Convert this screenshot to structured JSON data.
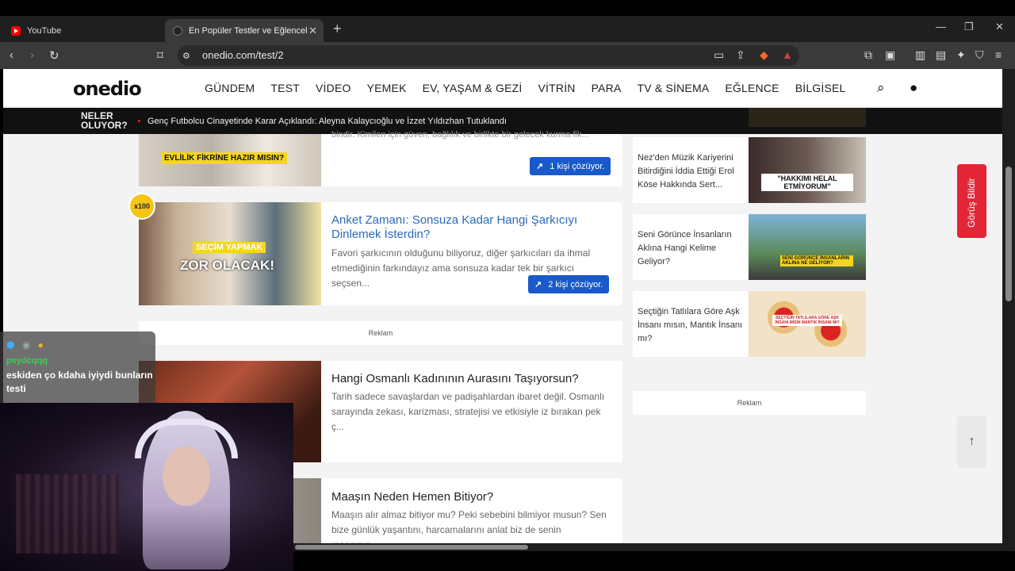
{
  "browser": {
    "tabs": [
      {
        "label": "YouTube",
        "active": false
      },
      {
        "label": "En Popüler Testler ve Eğlenceli Q",
        "active": true
      }
    ],
    "url": "onedio.com/test/2"
  },
  "header": {
    "logo": "onedio",
    "nav": [
      "GÜNDEM",
      "TEST",
      "VİDEO",
      "YEMEK",
      "EV, YAŞAM & GEZİ",
      "VİTRİN",
      "PARA",
      "TV & SİNEMA",
      "EĞLENCE",
      "BİLGİSEL"
    ]
  },
  "ticker": {
    "label": "NELER OLUYOR?",
    "text": "Genç Futbolcu Cinayetinde Karar Açıklandı: Aleyna Kalaycıoğlu ve İzzet Yıldızhan Tutuklandı"
  },
  "cards": [
    {
      "image_text": "EVLİLİK FİKRİNE HAZIR MISIN?",
      "desc_partial": "bindir. Kimilen için güven, bağlılık ve birlikte bir gelecek kurma fik...",
      "solvers": "1 kişi çözüyor."
    },
    {
      "badge": "x100",
      "image_text_1": "SEÇİM YAPMAK",
      "image_text_2": "ZOR OLACAK!",
      "title": "Anket Zamanı: Sonsuza Kadar Hangi Şarkıcıyı Dinlemek İsterdin?",
      "desc": "Favori şarkıcının olduğunu biliyoruz, diğer şarkıcıları da ihmal etmediğinin farkındayız ama sonsuza kadar tek bir şarkıcı seçsen...",
      "solvers": "2 kişi çözüyor."
    },
    {
      "title": "Hangi Osmanlı Kadınının Aurasını Taşıyorsun?",
      "desc": "Tarih sadece savaşlardan ve padişahlardan ibaret değil. Osmanlı sarayında zekası, karizması, stratejisi ve etkisiyle iz bırakan pek ç..."
    },
    {
      "title": "Maaşın Neden Hemen Bitiyor?",
      "desc": "Maaşın alır almaz bitiyor mu? Peki sebebini bilmiyor musun? Sen bize günlük yaşantını, harcamalarını anlat biz de senin maaşının..."
    }
  ],
  "ad_label": "Reklam",
  "sidebar": [
    {
      "title": "Nez'den Müzik Kariyerini Bitirdiğini İddia Ettiği Erol Köse Hakkında Sert...",
      "img_text": "\"HAKKIMI HELAL ETMİYORUM\""
    },
    {
      "title": "Seni Görünce İnsanların Aklına Hangi Kelime Geliyor?",
      "img_text": "SENİ GÖRÜNCE İNSANLARIN AKLINA NE GELİYOR?"
    },
    {
      "title": "Seçtiğin Tatlılara Göre Aşk İnsanı mısın, Mantık İnsanı mı?",
      "img_text": "SEÇTİĞİN TATLILARA GÖRE AŞK İNSANI MISIN MANTIK İNSANI MI?"
    }
  ],
  "feedback": "Görüş Bildir",
  "chat": {
    "user": "psydcqqq",
    "message": "eskiden ço kdaha iyiydi bunların testi"
  },
  "colors": {
    "accent_blue": "#1959c9",
    "feedback_red": "#e32636",
    "link_blue": "#2a6ab8"
  }
}
